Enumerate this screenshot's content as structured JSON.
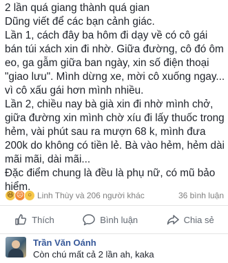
{
  "post": {
    "lines": [
      "2 lần quá giang thành quá gian",
      "Dũng viết để các bạn cảnh giác.",
      "Lần 1, cách đây ba hôm đi dạy về có cô gái bán túi xách xin đi nhờ. Giữa đường, cô đó ôm eo, ga gẫm giữa ban ngày, xin số điện thoại \"giao lưu\". Mình dừng xe, mời cô xuống ngay... vì cô xấu gái hơn mình nhiều.",
      "Lần 2, chiều nay bà già xin đi nhờ mình chở, giữa đường xin mình chờ xíu đi lấy thuốc trong hẻm, vài phút sau ra mượn 68 k, mình đưa 200k do không có tiền lẻ. Bà vào hẻm, hẻm dài mãi mãi, dài mãi...",
      "Đặc điểm chung là đều là phụ nữ, có mũ bảo hiểm."
    ]
  },
  "reactions": {
    "icons": [
      "haha-icon",
      "angry-icon",
      "wow-icon"
    ],
    "names": "Linh Thùy và 206 người khác",
    "comments": "36 bình luận"
  },
  "actions": {
    "like": "Thích",
    "comment": "Bình luận",
    "share": "Chia sẻ"
  },
  "comment": {
    "author": "Trần Văn Oánh",
    "text": "Còn chú mất cả 2 lần ah, kaka"
  }
}
